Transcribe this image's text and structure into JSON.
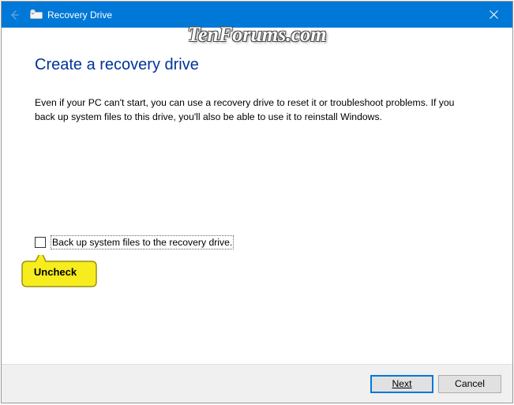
{
  "titlebar": {
    "title": "Recovery Drive"
  },
  "content": {
    "heading": "Create a recovery drive",
    "body": "Even if your PC can't start, you can use a recovery drive to reset it or troubleshoot problems. If you back up system files to this drive, you'll also be able to use it to reinstall Windows."
  },
  "checkbox": {
    "label": "Back up system files to the recovery drive.",
    "checked": false
  },
  "callout": {
    "text": "Uncheck"
  },
  "footer": {
    "next": "Next",
    "cancel": "Cancel"
  },
  "watermark": "TenForums.com"
}
